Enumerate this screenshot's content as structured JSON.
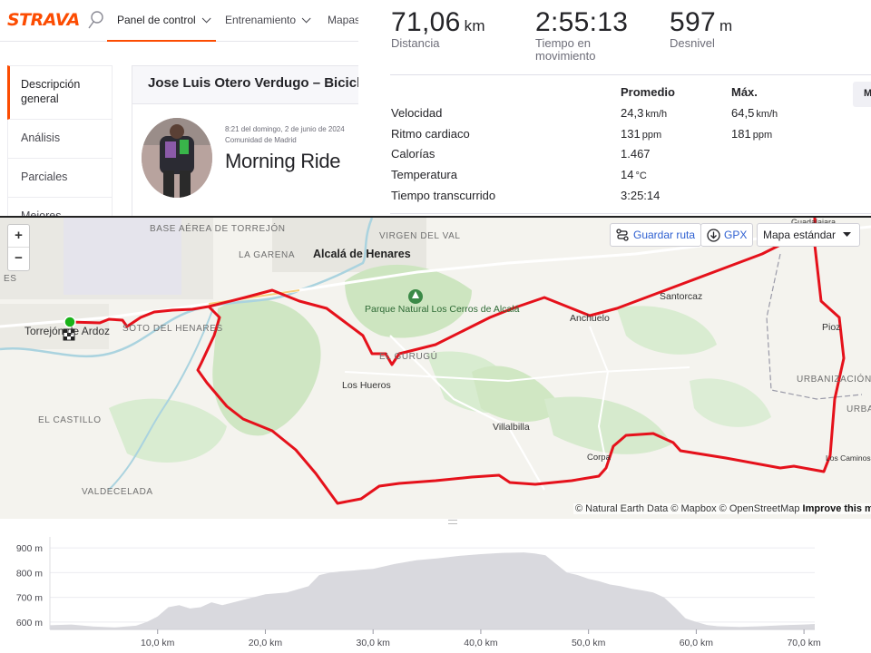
{
  "header": {
    "logo": "STRAVA",
    "nav": [
      {
        "label": "Panel de control",
        "active": true
      },
      {
        "label": "Entrenamiento",
        "active": false
      },
      {
        "label": "Mapas",
        "active": false
      }
    ]
  },
  "sidebar": {
    "items": [
      {
        "label": "Descripción general"
      },
      {
        "label": "Análisis"
      },
      {
        "label": "Parciales"
      },
      {
        "label": "Mejores"
      }
    ]
  },
  "activity": {
    "athlete_header": "Jose Luis Otero Verdugo – Bicicleta",
    "datetime": "8:21 del domingo, 2 de junio de 2024",
    "location": "Comunidad de Madrid",
    "title": "Morning Ride"
  },
  "stats": {
    "distance": {
      "value": "71,06",
      "unit": "km",
      "label": "Distancia"
    },
    "moving_time": {
      "value": "2:55:13",
      "label_line1": "Tiempo en",
      "label_line2": "movimiento"
    },
    "elevation": {
      "value": "597",
      "unit": "m",
      "label": "Desnivel"
    },
    "col_avg": "Promedio",
    "col_max": "Máx.",
    "more_button": "M",
    "rows": [
      {
        "label": "Velocidad",
        "avg": "24,3",
        "avg_unit": "km/h",
        "max": "64,5",
        "max_unit": "km/h"
      },
      {
        "label": "Ritmo cardiaco",
        "avg": "131",
        "avg_unit": "ppm",
        "max": "181",
        "max_unit": "ppm"
      },
      {
        "label": "Calorías",
        "avg": "1.467",
        "avg_unit": "",
        "max": "",
        "max_unit": ""
      },
      {
        "label": "Temperatura",
        "avg": "14",
        "avg_unit": "°C",
        "max": "",
        "max_unit": ""
      },
      {
        "label": "Tiempo transcurrido",
        "avg": "3:25:14",
        "avg_unit": "",
        "max": "",
        "max_unit": ""
      }
    ]
  },
  "map": {
    "controls": {
      "zoom_in": "+",
      "zoom_out": "−",
      "save_route": "Guardar ruta",
      "gpx": "GPX",
      "map_style": "Mapa estándar"
    },
    "labels": {
      "base_aerea": "BASE AÉREA DE TORREJÓN",
      "la_garena": "LA GARENA",
      "alcala": "Alcalá de Henares",
      "virgen": "VIRGEN DEL VAL",
      "guadalajara": "Guadalajara",
      "parque": "Parque Natural Los Cerros de Alcalá",
      "santorcaz": "Santorcaz",
      "anchuelo": "Anchuelo",
      "pioz": "Pioz",
      "torrejon": "Torrejón de Ardoz",
      "soto": "SOTO DEL HENARES",
      "gurugu": "EL GURUGÚ",
      "los_hueros": "Los Hueros",
      "urbanizacion": "URBANIZACIÓN LAS MATILLAS",
      "el_castillo": "EL CASTILLO",
      "villalbilla": "Villalbilla",
      "urbano": "URBANO",
      "corpa": "Corpa",
      "los_caminos": "Los Caminos",
      "valdecelada": "VALDECELADA",
      "es": "ES"
    },
    "attribution": "© Natural Earth Data © Mapbox © OpenStreetMap",
    "attribution_link": "Improve this map",
    "colors": {
      "route": "#e5111b",
      "start": "#19b219",
      "water": "#aad3df",
      "green": "#cfe7c2"
    }
  },
  "elevation_profile": {
    "type": "area",
    "xlabel": "",
    "ylabel": "",
    "y_ticks": [
      "900 m",
      "800 m",
      "700 m",
      "600 m"
    ],
    "x_ticks": [
      "10,0 km",
      "20,0 km",
      "30,0 km",
      "40,0 km",
      "50,0 km",
      "60,0 km",
      "70,0 km"
    ],
    "chart_data": {
      "type": "area",
      "x_unit": "km",
      "y_unit": "m",
      "xlim": [
        0,
        71
      ],
      "ylim": [
        570,
        930
      ],
      "x": [
        0,
        2,
        4,
        6,
        8,
        9,
        10,
        11,
        12,
        13,
        14,
        15,
        16,
        18,
        20,
        22,
        24,
        25,
        26,
        27,
        28,
        29,
        30,
        32,
        34,
        36,
        38,
        40,
        42,
        44,
        45,
        46,
        47,
        48,
        49,
        50,
        51,
        52,
        53,
        54,
        55,
        56,
        57,
        58,
        59,
        60,
        61,
        62,
        64,
        66,
        68,
        70,
        71
      ],
      "y": [
        587,
        590,
        582,
        578,
        585,
        600,
        622,
        660,
        668,
        655,
        660,
        680,
        668,
        690,
        712,
        720,
        745,
        790,
        800,
        805,
        808,
        812,
        815,
        835,
        850,
        858,
        868,
        875,
        880,
        882,
        878,
        870,
        835,
        800,
        790,
        775,
        765,
        752,
        745,
        735,
        728,
        720,
        700,
        660,
        615,
        600,
        588,
        583,
        580,
        583,
        587,
        590,
        592
      ],
      "color": "#d9d9de"
    }
  }
}
